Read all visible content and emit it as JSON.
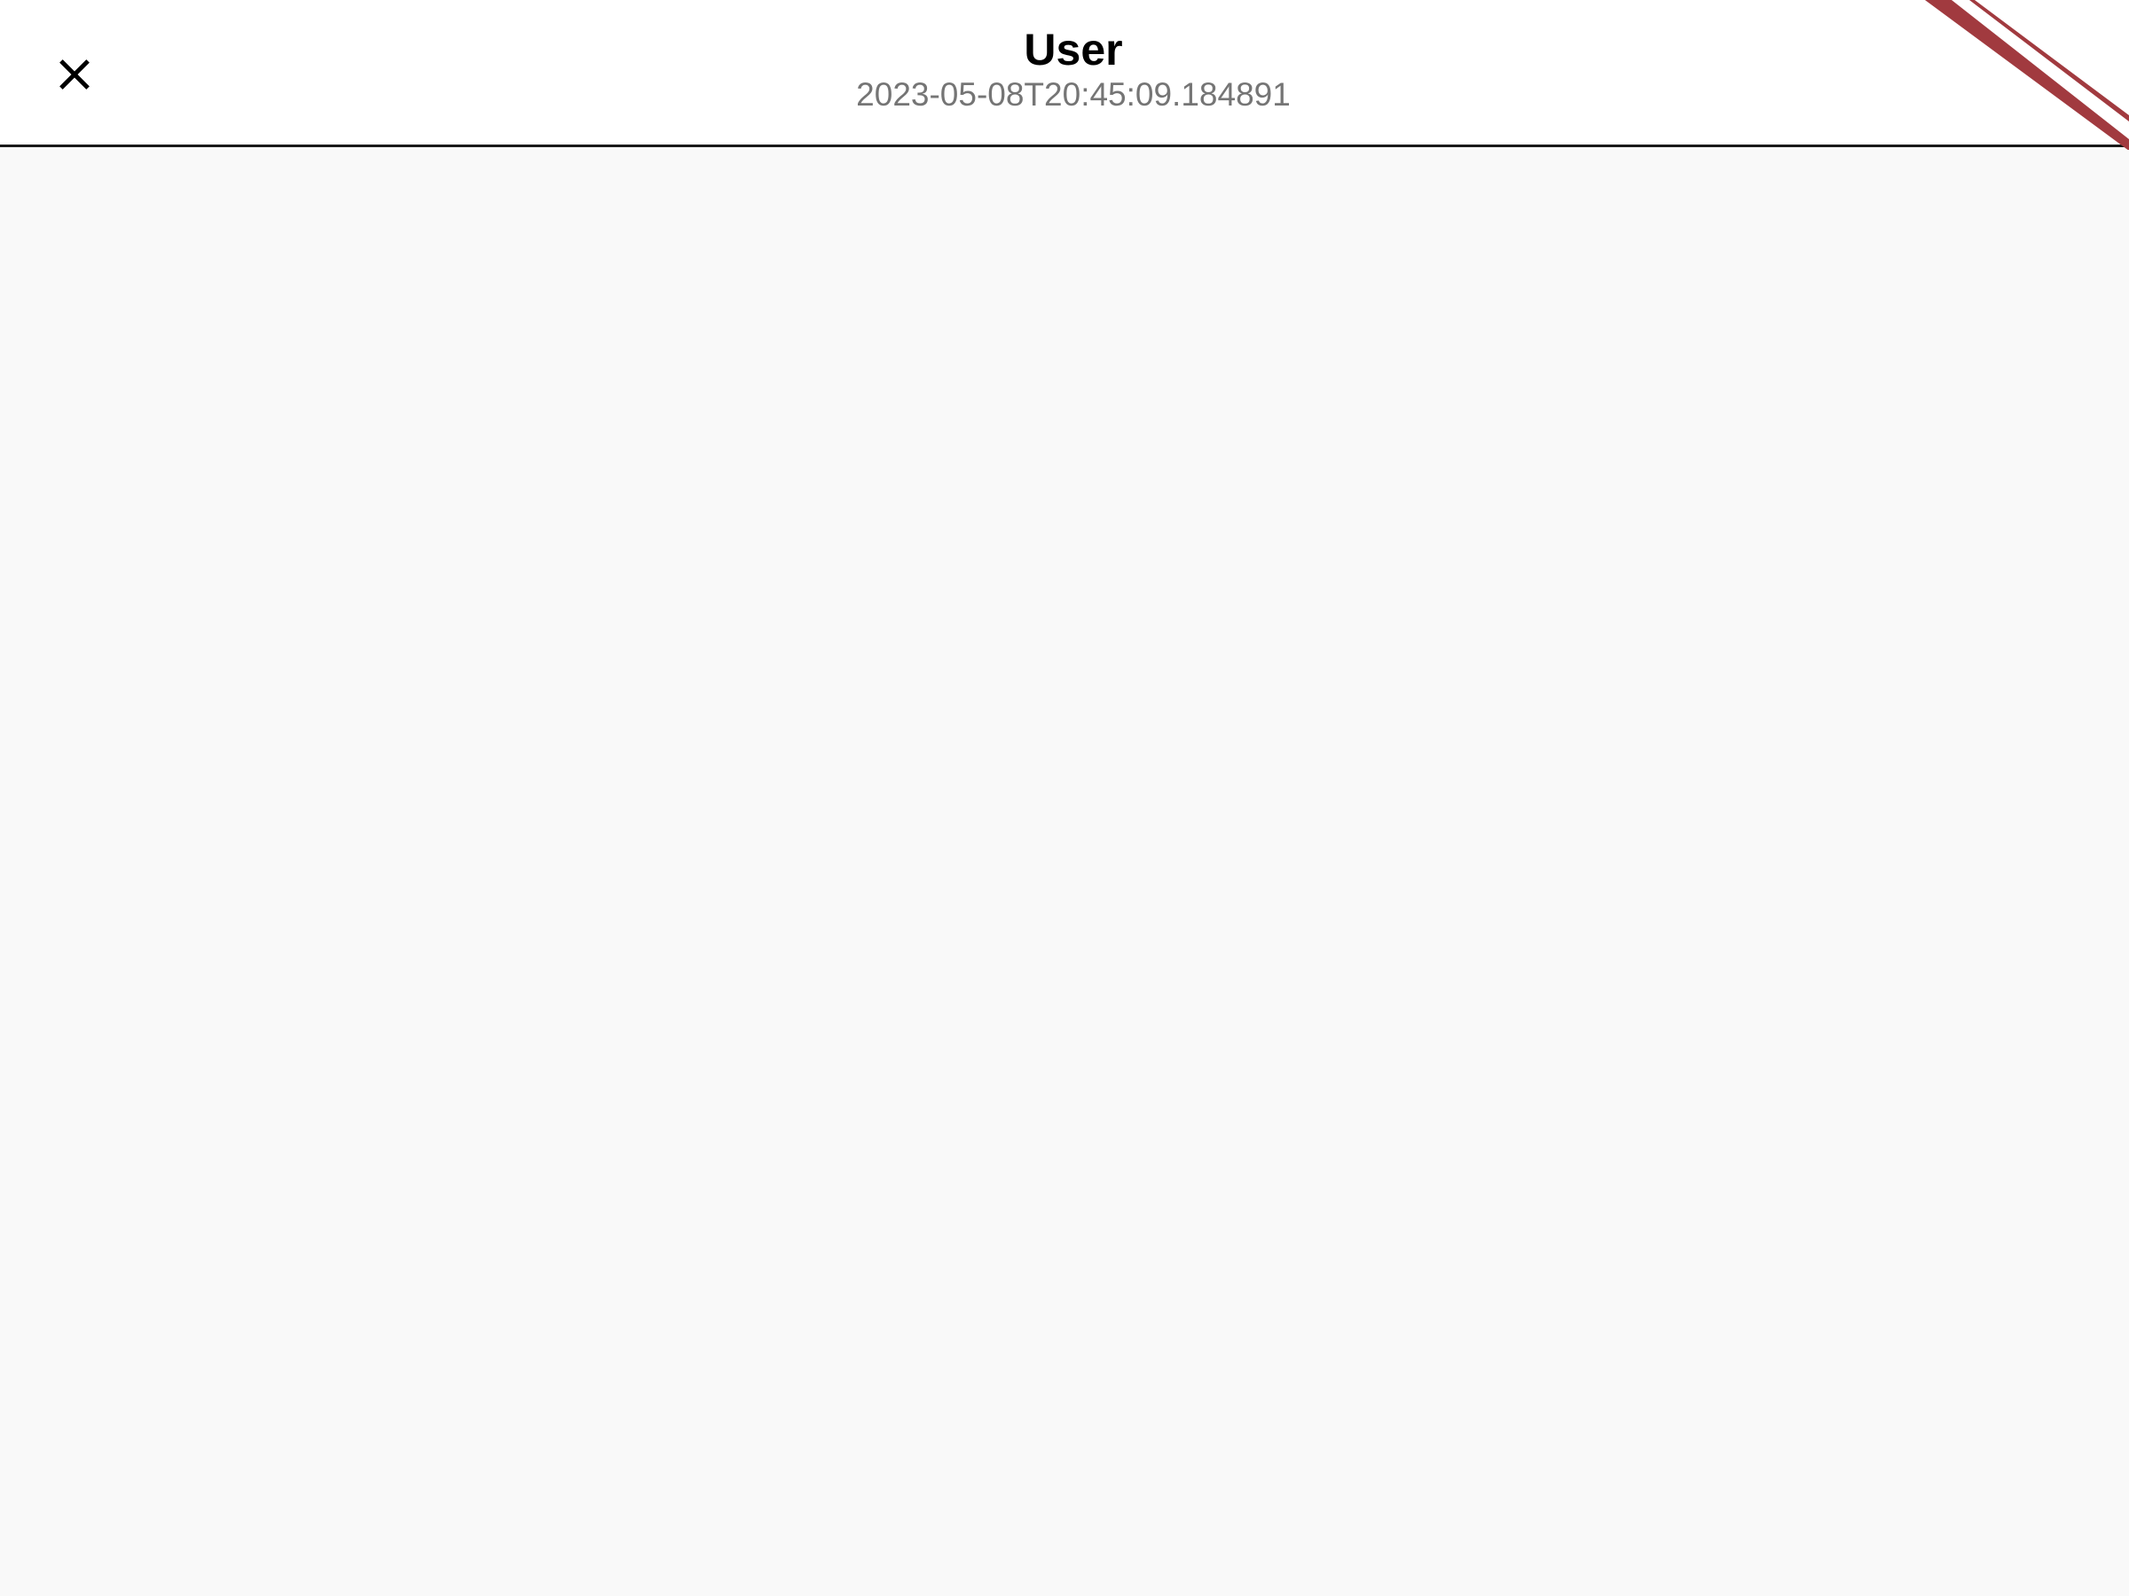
{
  "app_bar": {
    "title": "User",
    "subtitle": "2023-05-08T20:45:09.184891",
    "close_icon": "close-icon",
    "menu_icon": "more-vert-icon"
  },
  "debug_banner": {
    "colors": {
      "stripe": "#a13a3f"
    }
  },
  "colors": {
    "app_bar_bg": "#ffffff",
    "body_bg": "#f9f9f9",
    "subtitle": "#757575"
  }
}
